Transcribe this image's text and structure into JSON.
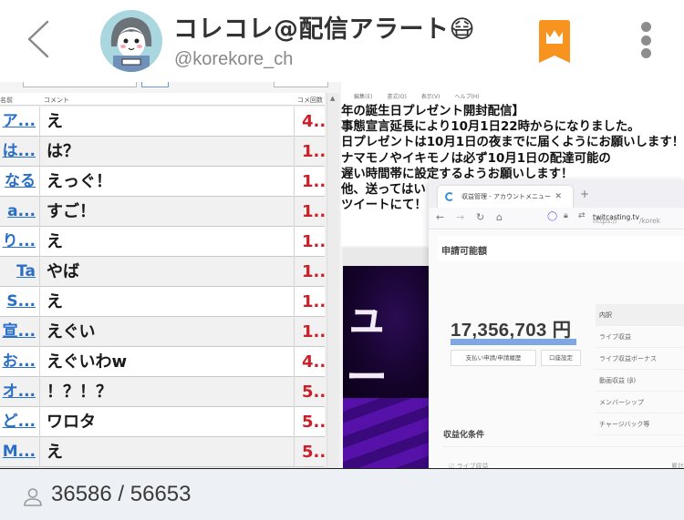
{
  "header": {
    "title": "コレコレ@配信アラート",
    "title_emoji": "😷",
    "handle": "@korekore_ch",
    "colors": {
      "bookmark": "#f7931e",
      "more_dots": "#8d8d8d"
    }
  },
  "comment_viewer": {
    "columns": [
      "名前",
      "コメント",
      "コメ回数"
    ],
    "rows": [
      {
        "name": "ア...",
        "comment": "え",
        "count": "4.."
      },
      {
        "name": "は...",
        "comment": "は？",
        "count": "1.."
      },
      {
        "name": "なる",
        "comment": "えっぐ！",
        "count": "1.."
      },
      {
        "name": "a...",
        "comment": "すご！",
        "count": "1.."
      },
      {
        "name": "り...",
        "comment": "え",
        "count": "1.."
      },
      {
        "name": "Ta",
        "comment": "やば",
        "count": "1.."
      },
      {
        "name": "S...",
        "comment": "え",
        "count": "1.."
      },
      {
        "name": "宣...",
        "comment": "えぐい",
        "count": "1.."
      },
      {
        "name": "お...",
        "comment": "えぐいわw",
        "count": "4.."
      },
      {
        "name": "オ...",
        "comment": "！？！？",
        "count": "5.."
      },
      {
        "name": "ど...",
        "comment": "ワロタ",
        "count": "5.."
      },
      {
        "name": "M...",
        "comment": "え",
        "count": "5.."
      }
    ]
  },
  "notepad": {
    "menu": [
      "編集(E)",
      "書式(O)",
      "表示(V)",
      "ヘルプ(H)"
    ],
    "lines": [
      "年の誕生日プレゼント開封配信】",
      " 事態宣言延長により10月1日22時からになりました。",
      " 日プレゼントは10月1日の夜までに届くようにお願いします！",
      "ナマモノやイキモノは必ず10月1日の配達可能の",
      " 遅い時間帯に設定するようお願いします！",
      "他、送ってはい",
      "ツイートにて！"
    ]
  },
  "video": {
    "overlay_text": "ュー"
  },
  "browser": {
    "tab_title": "収益管理 - アカウントメニュー",
    "url_prefix": "https://",
    "url_host": "twitcasting.tv",
    "url_rest": "/korek",
    "section_title": "申請可能額",
    "amount": "17,356,703 円",
    "progress_percent": 100,
    "buttons": [
      "支払い申請/申請履歴",
      "口座設定"
    ],
    "breakdown_header": "内訳",
    "breakdown_items": [
      "ライブ収益",
      "ライブ収益ボーナス",
      "動画収益 (β)",
      "メンバーシップ",
      "チャージバック等"
    ],
    "conditions_title": "収益化条件",
    "condition_item": "ライブ収益",
    "condition_right": "累計"
  },
  "footer": {
    "viewers": "36586 / 56653"
  }
}
